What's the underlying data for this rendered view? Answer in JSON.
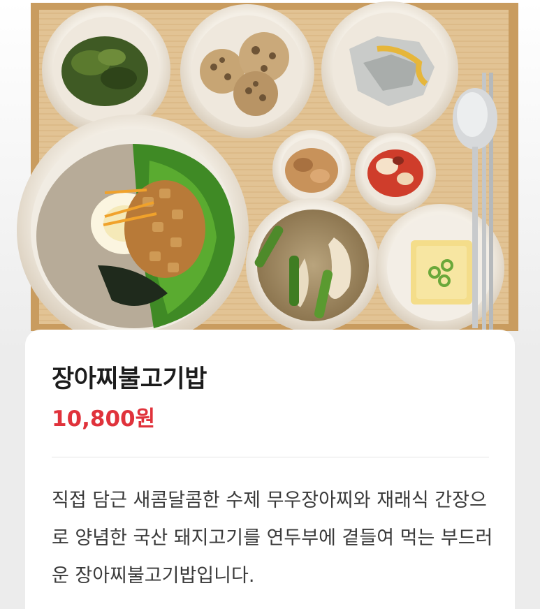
{
  "product": {
    "name": "장아찌불고기밥",
    "price": "10,800원",
    "description": "직접 담근 새콤달콤한 수제 무우장아찌와 재래식 간장으로 양념한 국산 돼지고기를 연두부에 곁들여 먹는 부드러운 장아찌불고기밥입니다."
  },
  "colors": {
    "price": "#e0323b",
    "tray": "#e2c394",
    "card": "#ffffff"
  }
}
